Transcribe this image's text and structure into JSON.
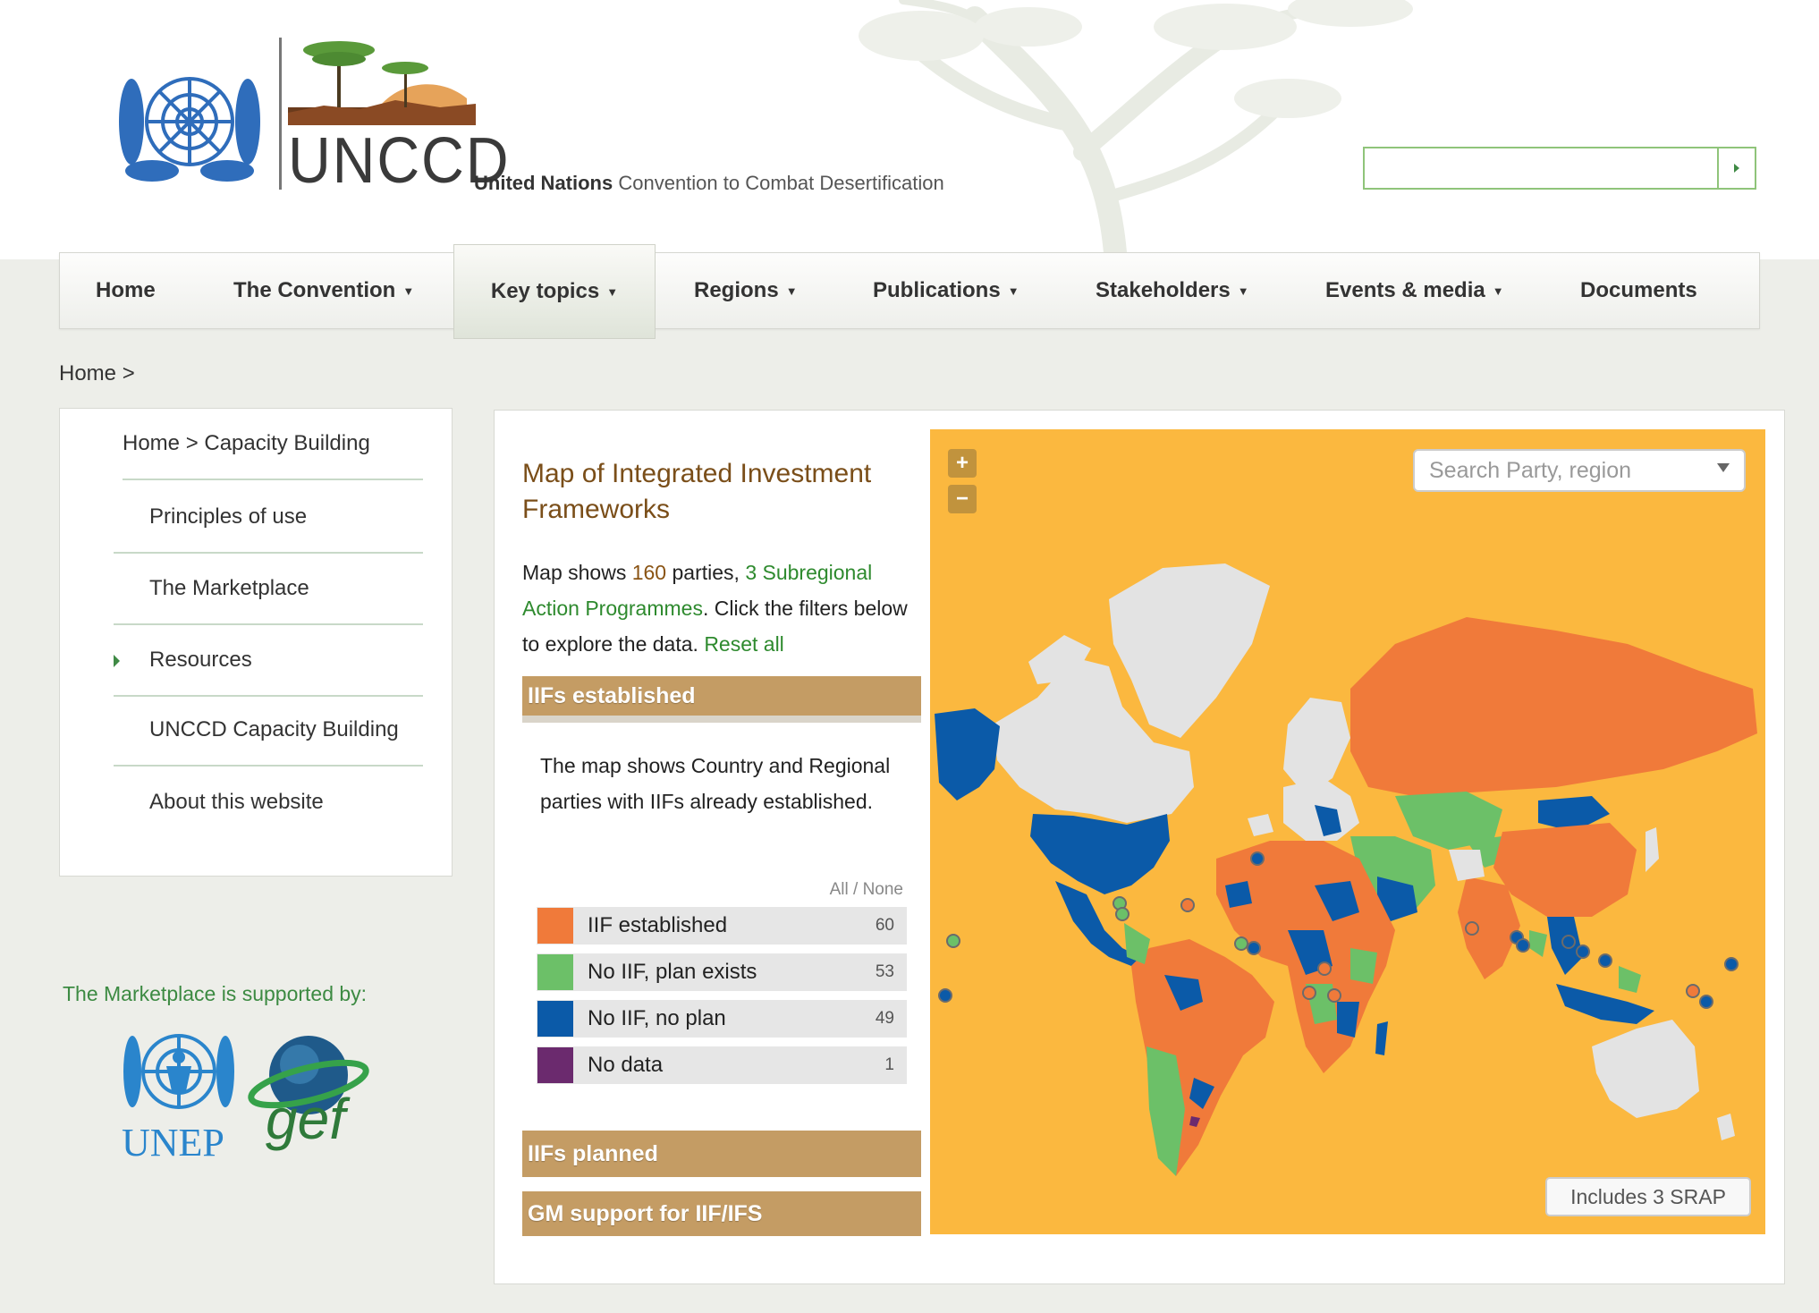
{
  "header": {
    "logo_text": "UNCCD",
    "tagline_bold": "United Nations",
    "tagline_rest": " Convention to Combat Desertification",
    "search": {
      "value": "",
      "placeholder": ""
    }
  },
  "nav": {
    "items": [
      {
        "label": "Home",
        "dropdown": false
      },
      {
        "label": "The Convention",
        "dropdown": true
      },
      {
        "label": "Key topics",
        "dropdown": true,
        "active": true
      },
      {
        "label": "Regions",
        "dropdown": true
      },
      {
        "label": "Publications",
        "dropdown": true
      },
      {
        "label": "Stakeholders",
        "dropdown": true
      },
      {
        "label": "Events & media",
        "dropdown": true
      },
      {
        "label": "Documents",
        "dropdown": false
      }
    ]
  },
  "breadcrumb": "Home >",
  "sidebar": {
    "items": [
      {
        "label": "Home > Capacity Building"
      },
      {
        "label": "Principles of use"
      },
      {
        "label": "The Marketplace"
      },
      {
        "label": "Resources",
        "current": true
      },
      {
        "label": "UNCCD Capacity Building"
      },
      {
        "label": "About this website"
      }
    ],
    "supported_by": "The Marketplace is supported by:",
    "sponsors": [
      "UNEP",
      "gef"
    ]
  },
  "panel": {
    "title": "Map of Integrated Investment Frameworks",
    "desc_prefix": "Map shows ",
    "parties_count": "160",
    "desc_mid": " parties, ",
    "srap_link": "3 Subregional Action Programmes",
    "desc_suffix": ". Click the filters below to explore the data. ",
    "reset_label": "Reset all",
    "accordion": [
      {
        "label": "IIFs established",
        "open": true
      },
      {
        "label": "IIFs planned",
        "open": false
      },
      {
        "label": "GM support for IIF/IFS",
        "open": false
      }
    ],
    "accordion_body": "The map shows Country and Regional parties with IIFs already established.",
    "all_none": "All / None",
    "legend": [
      {
        "label": "IIF established",
        "count": "60",
        "color": "#f07a3a"
      },
      {
        "label": "No IIF, plan exists",
        "count": "53",
        "color": "#6cc068"
      },
      {
        "label": "No IIF, no plan",
        "count": "49",
        "color": "#0b5aa8"
      },
      {
        "label": "No data",
        "count": "1",
        "color": "#6b2a6e"
      }
    ]
  },
  "map": {
    "ocean_color": "#fbb83f",
    "nodata_land_color": "#e3e3e3",
    "zoom_in": "+",
    "zoom_out": "−",
    "search_placeholder": "Search Party, region",
    "srap_button": "Includes 3 SRAP"
  }
}
